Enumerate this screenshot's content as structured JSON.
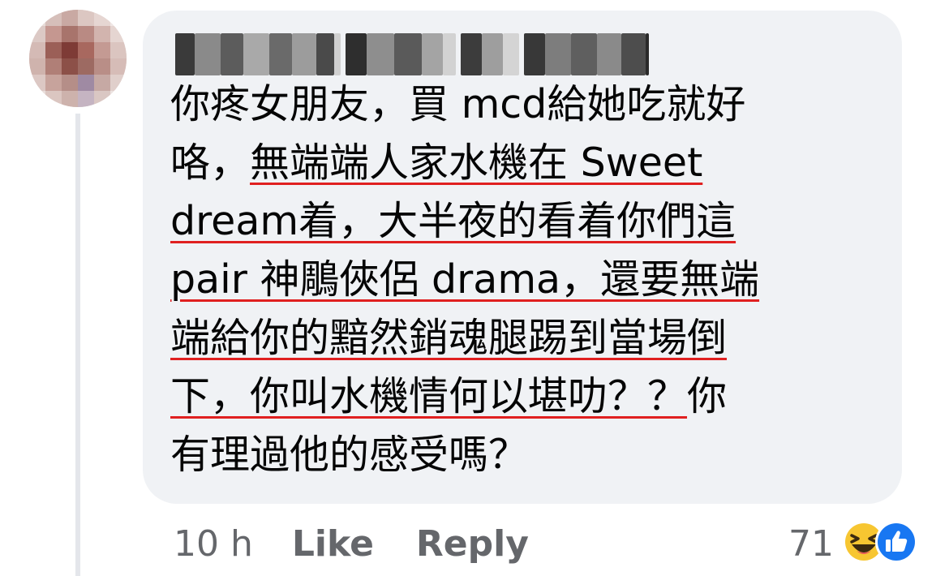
{
  "comment": {
    "author_name": "[blurred name]",
    "lines": [
      "你疼女朋友，買 mcd給她吃就好",
      "咯，",
      "無端端人家水機在 Sweet",
      "dream着，大半夜的看着你們這",
      "pair 神鵰俠侶 drama，還要無端",
      "端給你的黯然銷魂腿踢到當場倒",
      "下，你叫水機情何以堪叻？？",
      "你",
      "有理過他的感受嗎？"
    ],
    "underline_color": "#e02020"
  },
  "actions": {
    "timestamp": "10 h",
    "like_label": "Like",
    "reply_label": "Reply"
  },
  "reactions": {
    "count": "71",
    "icons": [
      "haha-icon",
      "like-icon"
    ]
  },
  "colors": {
    "bubble": "#f0f2f5",
    "meta_text": "#65676b",
    "like_blue": "#1877f2",
    "haha_yellow": "#f7c631"
  }
}
